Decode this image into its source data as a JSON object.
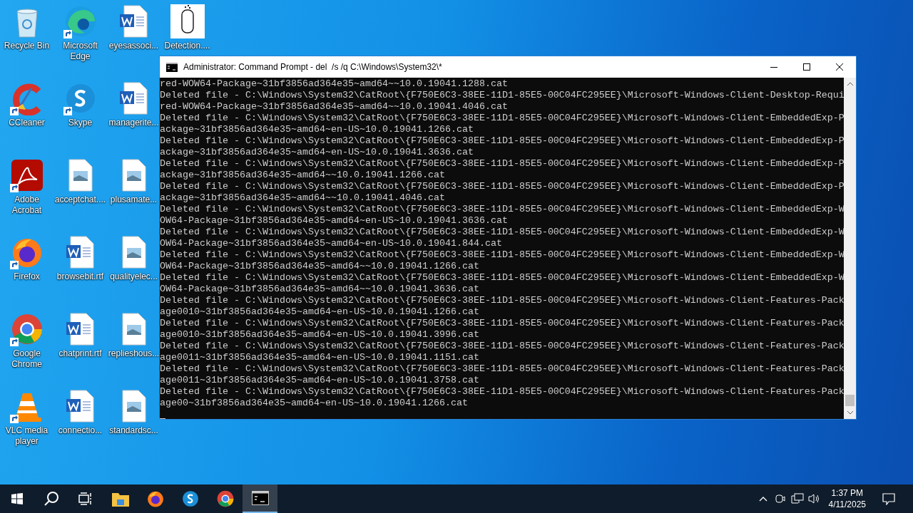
{
  "desktop_icons": [
    {
      "label": "Recycle Bin",
      "kind": "recycle-bin",
      "shortcut": false
    },
    {
      "label": "CCleaner",
      "kind": "ccleaner",
      "shortcut": true
    },
    {
      "label": "Adobe Acrobat",
      "kind": "acrobat",
      "shortcut": true
    },
    {
      "label": "Firefox",
      "kind": "firefox",
      "shortcut": true
    },
    {
      "label": "Google Chrome",
      "kind": "chrome",
      "shortcut": true
    },
    {
      "label": "VLC media player",
      "kind": "vlc",
      "shortcut": true
    },
    {
      "label": "Microsoft Edge",
      "kind": "edge",
      "shortcut": true
    },
    {
      "label": "Skype",
      "kind": "skype",
      "shortcut": true
    },
    {
      "label": "acceptchat....",
      "kind": "image-file",
      "shortcut": false
    },
    {
      "label": "browsebit.rtf",
      "kind": "word-file",
      "shortcut": false
    },
    {
      "label": "chatprint.rtf",
      "kind": "word-file",
      "shortcut": false
    },
    {
      "label": "connectio...",
      "kind": "word-file",
      "shortcut": false
    },
    {
      "label": "eyesassoci...",
      "kind": "word-file",
      "shortcut": false
    },
    {
      "label": "managerite...",
      "kind": "word-file",
      "shortcut": false
    },
    {
      "label": "plusamate...",
      "kind": "image-file",
      "shortcut": false
    },
    {
      "label": "qualityelec...",
      "kind": "image-file",
      "shortcut": false
    },
    {
      "label": "replieshous...",
      "kind": "image-file",
      "shortcut": false
    },
    {
      "label": "standardsc...",
      "kind": "image-file",
      "shortcut": false
    },
    {
      "label": "Detection....",
      "kind": "thumbnail",
      "shortcut": false
    }
  ],
  "window": {
    "title": "Administrator: Command Prompt - del  /s /q C:\\Windows\\System32\\*",
    "lines": [
      "red-WOW64-Package~31bf3856ad364e35~amd64~~10.0.19041.1288.cat",
      "Deleted file - C:\\Windows\\System32\\CatRoot\\{F750E6C3-38EE-11D1-85E5-00C04FC295EE}\\Microsoft-Windows-Client-Desktop-Requi",
      "red-WOW64-Package~31bf3856ad364e35~amd64~~10.0.19041.4046.cat",
      "Deleted file - C:\\Windows\\System32\\CatRoot\\{F750E6C3-38EE-11D1-85E5-00C04FC295EE}\\Microsoft-Windows-Client-EmbeddedExp-P",
      "ackage~31bf3856ad364e35~amd64~en-US~10.0.19041.1266.cat",
      "Deleted file - C:\\Windows\\System32\\CatRoot\\{F750E6C3-38EE-11D1-85E5-00C04FC295EE}\\Microsoft-Windows-Client-EmbeddedExp-P",
      "ackage~31bf3856ad364e35~amd64~en-US~10.0.19041.3636.cat",
      "Deleted file - C:\\Windows\\System32\\CatRoot\\{F750E6C3-38EE-11D1-85E5-00C04FC295EE}\\Microsoft-Windows-Client-EmbeddedExp-P",
      "ackage~31bf3856ad364e35~amd64~~10.0.19041.1266.cat",
      "Deleted file - C:\\Windows\\System32\\CatRoot\\{F750E6C3-38EE-11D1-85E5-00C04FC295EE}\\Microsoft-Windows-Client-EmbeddedExp-P",
      "ackage~31bf3856ad364e35~amd64~~10.0.19041.4046.cat",
      "Deleted file - C:\\Windows\\System32\\CatRoot\\{F750E6C3-38EE-11D1-85E5-00C04FC295EE}\\Microsoft-Windows-Client-EmbeddedExp-W",
      "OW64-Package~31bf3856ad364e35~amd64~en-US~10.0.19041.3636.cat",
      "Deleted file - C:\\Windows\\System32\\CatRoot\\{F750E6C3-38EE-11D1-85E5-00C04FC295EE}\\Microsoft-Windows-Client-EmbeddedExp-W",
      "OW64-Package~31bf3856ad364e35~amd64~en-US~10.0.19041.844.cat",
      "Deleted file - C:\\Windows\\System32\\CatRoot\\{F750E6C3-38EE-11D1-85E5-00C04FC295EE}\\Microsoft-Windows-Client-EmbeddedExp-W",
      "OW64-Package~31bf3856ad364e35~amd64~~10.0.19041.1266.cat",
      "Deleted file - C:\\Windows\\System32\\CatRoot\\{F750E6C3-38EE-11D1-85E5-00C04FC295EE}\\Microsoft-Windows-Client-EmbeddedExp-W",
      "OW64-Package~31bf3856ad364e35~amd64~~10.0.19041.3636.cat",
      "Deleted file - C:\\Windows\\System32\\CatRoot\\{F750E6C3-38EE-11D1-85E5-00C04FC295EE}\\Microsoft-Windows-Client-Features-Pack",
      "age0010~31bf3856ad364e35~amd64~en-US~10.0.19041.1266.cat",
      "Deleted file - C:\\Windows\\System32\\CatRoot\\{F750E6C3-38EE-11D1-85E5-00C04FC295EE}\\Microsoft-Windows-Client-Features-Pack",
      "age0010~31bf3856ad364e35~amd64~en-US~10.0.19041.3996.cat",
      "Deleted file - C:\\Windows\\System32\\CatRoot\\{F750E6C3-38EE-11D1-85E5-00C04FC295EE}\\Microsoft-Windows-Client-Features-Pack",
      "age0011~31bf3856ad364e35~amd64~en-US~10.0.19041.1151.cat",
      "Deleted file - C:\\Windows\\System32\\CatRoot\\{F750E6C3-38EE-11D1-85E5-00C04FC295EE}\\Microsoft-Windows-Client-Features-Pack",
      "age0011~31bf3856ad364e35~amd64~en-US~10.0.19041.3758.cat",
      "Deleted file - C:\\Windows\\System32\\CatRoot\\{F750E6C3-38EE-11D1-85E5-00C04FC295EE}\\Microsoft-Windows-Client-Features-Pack",
      "age00~31bf3856ad364e35~amd64~en-US~10.0.19041.1266.cat"
    ]
  },
  "taskbar": {
    "items": [
      {
        "kind": "start",
        "selected": false
      },
      {
        "kind": "search",
        "selected": false
      },
      {
        "kind": "task-view",
        "selected": false
      },
      {
        "kind": "explorer",
        "selected": false
      },
      {
        "kind": "firefox",
        "selected": false
      },
      {
        "kind": "skype",
        "selected": false
      },
      {
        "kind": "chrome",
        "selected": false
      },
      {
        "kind": "cmd",
        "selected": true
      }
    ],
    "tray": {
      "time": "1:37 PM",
      "date": "4/11/2025"
    }
  }
}
